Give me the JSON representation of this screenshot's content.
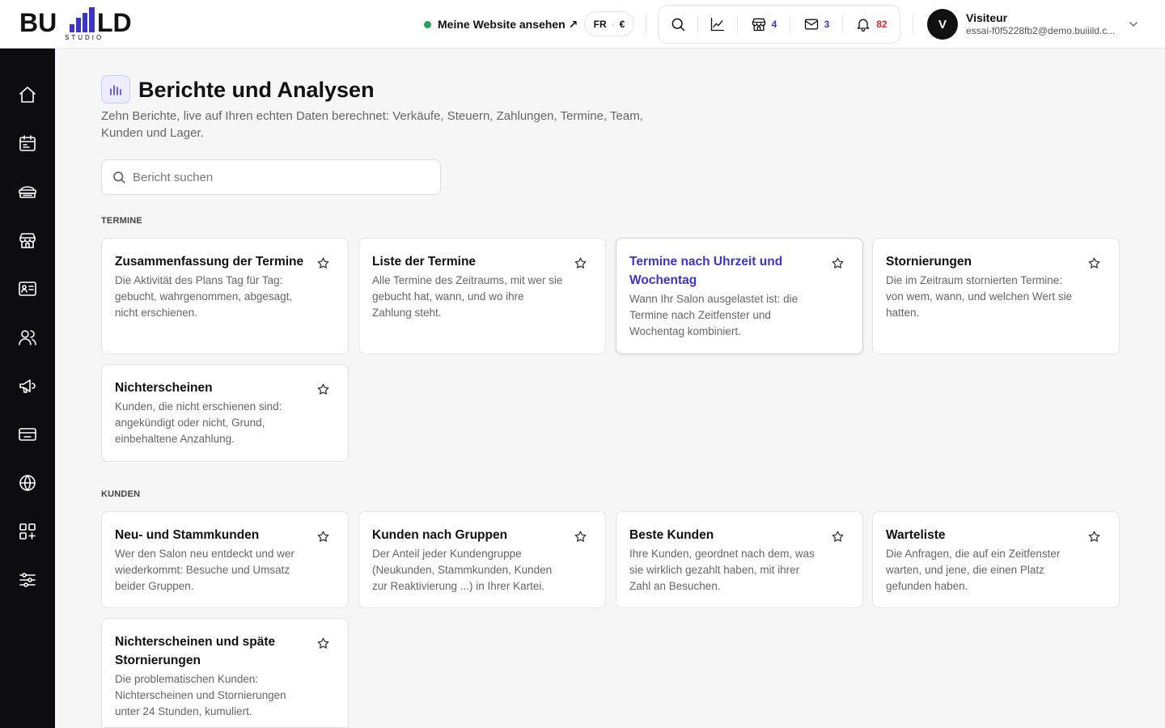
{
  "brand": {
    "word": "BU LD",
    "sub": "STUDIO"
  },
  "topbar": {
    "site_link": "Meine Website ansehen ↗",
    "lang": "FR",
    "currency": "€",
    "tools": [
      {
        "icon": "search-icon",
        "count": ""
      },
      {
        "icon": "chart-line-icon",
        "count": ""
      },
      {
        "icon": "store-icon",
        "count": "4"
      },
      {
        "icon": "mail-icon",
        "count": "3"
      },
      {
        "icon": "bell-icon",
        "count": "82"
      }
    ],
    "user": {
      "initial": "V",
      "name": "Visiteur",
      "email": "essai-f0f5228fb2@demo.buiiild.c..."
    }
  },
  "sidebar": {
    "items": [
      "home-icon",
      "calendar-icon",
      "services-icon",
      "store-icon",
      "contact-card-icon",
      "users-icon",
      "megaphone-icon",
      "payment-card-icon",
      "globe-icon",
      "apps-icon",
      "settings-sliders-icon"
    ]
  },
  "page": {
    "title": "Berichte und Analysen",
    "description": "Zehn Berichte, live auf Ihren echten Daten berechnet: Verkäufe, Steuern, Zahlungen, Termine, Team, Kunden und Lager.",
    "search_placeholder": "Bericht suchen"
  },
  "sections": [
    {
      "label": "TERMINE",
      "cards": [
        {
          "title": "Zusammenfassung der Termine",
          "desc": "Die Aktivität des Plans Tag für Tag: gebucht, wahrgenommen, abgesagt, nicht erschienen."
        },
        {
          "title": "Liste der Termine",
          "desc": "Alle Termine des Zeitraums, mit wer sie gebucht hat, wann, und wo ihre Zahlung steht."
        },
        {
          "title": "Termine nach Uhrzeit und Wochentag",
          "desc": "Wann Ihr Salon ausgelastet ist: die Termine nach Zeitfenster und Wochentag kombiniert."
        },
        {
          "title": "Stornierungen",
          "desc": "Die im Zeitraum stornierten Termine: von wem, wann, und welchen Wert sie hatten."
        },
        {
          "title": "Nichterscheinen",
          "desc": "Kunden, die nicht erschienen sind: angekündigt oder nicht, Grund, einbehaltene Anzahlung."
        }
      ]
    },
    {
      "label": "KUNDEN",
      "cards": [
        {
          "title": "Neu- und Stammkunden",
          "desc": "Wer den Salon neu entdeckt und wer wiederkommt: Besuche und Umsatz beider Gruppen."
        },
        {
          "title": "Kunden nach Gruppen",
          "desc": "Der Anteil jeder Kundengruppe (Neukunden, Stammkunden, Kunden zur Reaktivierung ...) in Ihrer Kartei."
        },
        {
          "title": "Beste Kunden",
          "desc": "Ihre Kunden, geordnet nach dem, was sie wirklich gezahlt haben, mit ihrer Zahl an Besuchen."
        },
        {
          "title": "Warteliste",
          "desc": "Die Anfragen, die auf ein Zeitfenster warten, und jene, die einen Platz gefunden haben."
        },
        {
          "title": "Nichterscheinen und späte Stornierungen",
          "desc": "Die problematischen Kunden: Nichterscheinen und Stornierungen unter 24 Stunden, kumuliert."
        }
      ]
    }
  ],
  "colors": {
    "accent": "#3b35c9",
    "alert": "#d02c2c",
    "online": "#22a55a",
    "sidebar": "#0d0d0f"
  }
}
